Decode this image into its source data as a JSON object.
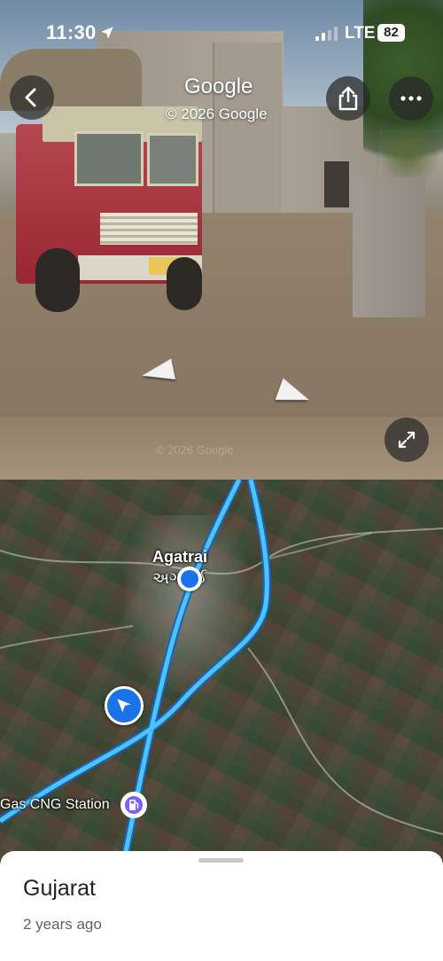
{
  "status_bar": {
    "time": "11:30",
    "network": "LTE",
    "battery": "82"
  },
  "street_view": {
    "provider": "Google",
    "copyright": "© 2026 Google",
    "watermark": "© 2026 Google",
    "icons": {
      "back": "chevron-left-icon",
      "share": "share-icon",
      "more": "more-horizontal-icon",
      "expand": "expand-icon"
    }
  },
  "map": {
    "place_name": "Agatrai",
    "place_name_local": "અગત્રાઈ",
    "poi_label": "Gas CNG Station",
    "colors": {
      "road": "#4fc3f7",
      "road_edge": "#1565c0",
      "accent": "#1a73e8"
    }
  },
  "sheet": {
    "title": "Gujarat",
    "subtitle": "2 years ago"
  }
}
